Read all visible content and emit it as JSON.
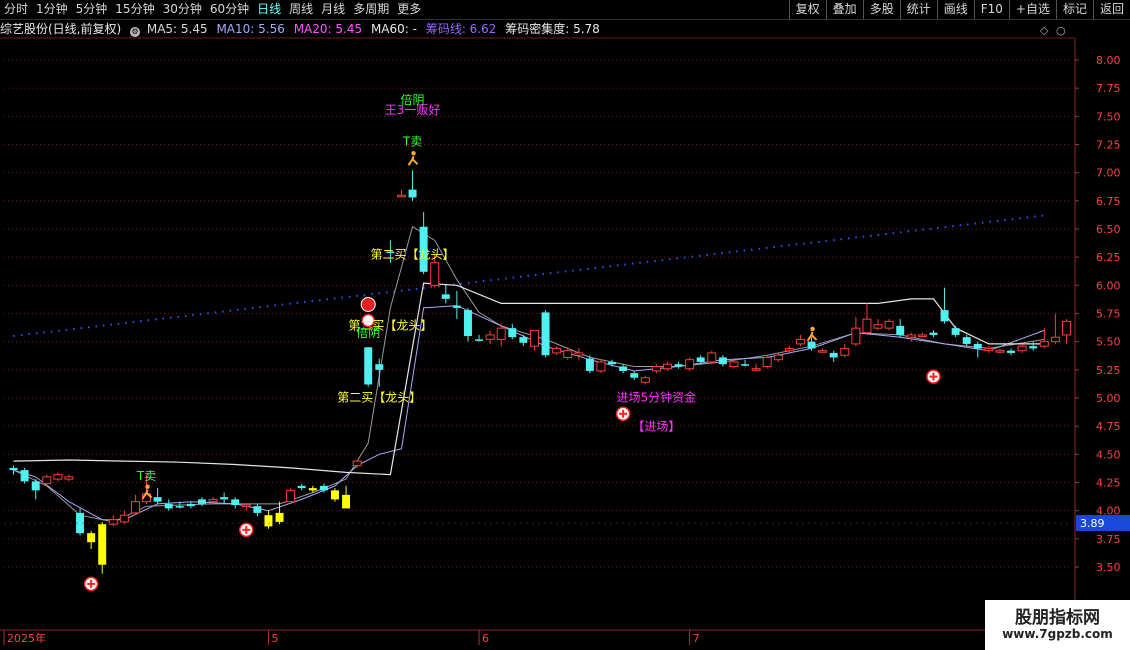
{
  "topbar": {
    "left": [
      "分时",
      "1分钟",
      "5分钟",
      "15分钟",
      "30分钟",
      "60分钟",
      "日线",
      "周线",
      "月线",
      "多周期",
      "更多"
    ],
    "active": "日线",
    "right": [
      "复权",
      "叠加",
      "多股",
      "统计",
      "画线",
      "F10",
      "+自选",
      "标记",
      "返回"
    ]
  },
  "info": {
    "stock": "综艺股份(日线,前复权)",
    "ma5": "MA5: 5.45",
    "ma10": "MA10: 5.56",
    "ma20": "MA20: 5.45",
    "ma60": "MA60: -",
    "chip_line": "筹码线: 6.62",
    "chip_density": "筹码密集度: 5.78"
  },
  "colors": {
    "up": "#ff3b3b",
    "down": "#4ff0f0",
    "special": "#ffff00",
    "ma_white": "#e6e6e6",
    "ma_purple": "#a8a8ff",
    "chip_blue": "#3050ff"
  },
  "chart_data": {
    "type": "candlestick",
    "ylim": [
      3.3,
      8.18
    ],
    "yticks": [
      "8.00",
      "7.75",
      "7.50",
      "7.25",
      "7.00",
      "6.75",
      "6.50",
      "6.25",
      "6.00",
      "5.75",
      "5.50",
      "5.25",
      "5.00",
      "4.75",
      "4.50",
      "4.25",
      "4.00",
      "3.75",
      "3.50"
    ],
    "current_price": "3.89",
    "x_labels": [
      {
        "label": "2025年",
        "index": 0
      },
      {
        "label": "5",
        "index": 23
      },
      {
        "label": "6",
        "index": 42
      },
      {
        "label": "7",
        "index": 61
      }
    ],
    "candles": [
      [
        4.38,
        4.36,
        4.4,
        4.32,
        "down"
      ],
      [
        4.36,
        4.26,
        4.38,
        4.24,
        "down"
      ],
      [
        4.26,
        4.18,
        4.28,
        4.1,
        "down"
      ],
      [
        4.24,
        4.3,
        4.32,
        4.22,
        "up"
      ],
      [
        4.28,
        4.32,
        4.34,
        4.26,
        "up"
      ],
      [
        4.3,
        4.28,
        4.32,
        4.26,
        "up"
      ],
      [
        3.98,
        3.8,
        4.02,
        3.78,
        "down"
      ],
      [
        3.8,
        3.72,
        3.82,
        3.66,
        "special"
      ],
      [
        3.88,
        3.52,
        3.9,
        3.44,
        "special"
      ],
      [
        3.88,
        3.92,
        3.96,
        3.86,
        "up"
      ],
      [
        3.9,
        3.96,
        4.0,
        3.88,
        "up"
      ],
      [
        3.98,
        4.08,
        4.14,
        3.96,
        "up"
      ],
      [
        4.08,
        4.15,
        4.32,
        4.06,
        "up"
      ],
      [
        4.12,
        4.08,
        4.2,
        4.06,
        "down"
      ],
      [
        4.06,
        4.02,
        4.1,
        4.0,
        "down"
      ],
      [
        4.04,
        4.04,
        4.08,
        4.02,
        "down"
      ],
      [
        4.04,
        4.06,
        4.08,
        4.02,
        "down"
      ],
      [
        4.06,
        4.1,
        4.12,
        4.04,
        "down"
      ],
      [
        4.08,
        4.1,
        4.12,
        4.06,
        "up"
      ],
      [
        4.1,
        4.12,
        4.16,
        4.06,
        "down"
      ],
      [
        4.1,
        4.05,
        4.12,
        4.02,
        "down"
      ],
      [
        4.04,
        4.05,
        4.06,
        4.0,
        "up"
      ],
      [
        4.04,
        3.98,
        4.06,
        3.95,
        "down"
      ],
      [
        3.96,
        3.86,
        4.0,
        3.84,
        "special"
      ],
      [
        3.9,
        3.98,
        4.08,
        3.88,
        "special"
      ],
      [
        4.08,
        4.18,
        4.2,
        4.08,
        "up"
      ],
      [
        4.22,
        4.2,
        4.24,
        4.18,
        "down"
      ],
      [
        4.18,
        4.2,
        4.22,
        4.16,
        "special"
      ],
      [
        4.22,
        4.18,
        4.24,
        4.16,
        "down"
      ],
      [
        4.18,
        4.1,
        4.2,
        4.08,
        "special"
      ],
      [
        4.14,
        4.02,
        4.22,
        4.02,
        "special"
      ],
      [
        4.4,
        4.44,
        4.44,
        4.38,
        "up"
      ],
      [
        5.12,
        5.45,
        5.45,
        5.1,
        "down"
      ],
      [
        5.3,
        5.25,
        5.35,
        5.1,
        "down"
      ],
      [
        6.3,
        6.3,
        6.4,
        6.2,
        "down"
      ],
      [
        6.8,
        6.8,
        6.85,
        6.78,
        "up"
      ],
      [
        6.85,
        6.78,
        7.02,
        6.75,
        "down"
      ],
      [
        6.52,
        6.12,
        6.65,
        6.1,
        "down"
      ],
      [
        6.0,
        6.2,
        6.28,
        5.98,
        "up"
      ],
      [
        5.92,
        5.88,
        6.0,
        5.84,
        "down"
      ],
      [
        5.82,
        5.8,
        5.95,
        5.7,
        "down"
      ],
      [
        5.78,
        5.55,
        5.8,
        5.5,
        "down"
      ],
      [
        5.52,
        5.52,
        5.56,
        5.5,
        "down"
      ],
      [
        5.52,
        5.56,
        5.6,
        5.48,
        "up"
      ],
      [
        5.52,
        5.62,
        5.66,
        5.46,
        "up"
      ],
      [
        5.62,
        5.54,
        5.66,
        5.52,
        "down"
      ],
      [
        5.54,
        5.49,
        5.56,
        5.46,
        "down"
      ],
      [
        5.46,
        5.6,
        5.6,
        5.42,
        "up"
      ],
      [
        5.76,
        5.38,
        5.78,
        5.36,
        "down"
      ],
      [
        5.4,
        5.44,
        5.46,
        5.38,
        "up"
      ],
      [
        5.42,
        5.36,
        5.45,
        5.34,
        "up"
      ],
      [
        5.38,
        5.4,
        5.44,
        5.34,
        "up"
      ],
      [
        5.35,
        5.24,
        5.38,
        5.22,
        "down"
      ],
      [
        5.24,
        5.32,
        5.34,
        5.22,
        "up"
      ],
      [
        5.32,
        5.3,
        5.34,
        5.28,
        "down"
      ],
      [
        5.28,
        5.24,
        5.3,
        5.22,
        "down"
      ],
      [
        5.22,
        5.18,
        5.24,
        5.16,
        "down"
      ],
      [
        5.14,
        5.18,
        5.2,
        5.12,
        "up"
      ],
      [
        5.24,
        5.28,
        5.3,
        5.22,
        "up"
      ],
      [
        5.26,
        5.3,
        5.32,
        5.24,
        "up"
      ],
      [
        5.3,
        5.28,
        5.32,
        5.26,
        "down"
      ],
      [
        5.26,
        5.34,
        5.36,
        5.24,
        "up"
      ],
      [
        5.36,
        5.32,
        5.38,
        5.3,
        "down"
      ],
      [
        5.32,
        5.4,
        5.42,
        5.3,
        "up"
      ],
      [
        5.36,
        5.3,
        5.38,
        5.28,
        "down"
      ],
      [
        5.28,
        5.32,
        5.34,
        5.26,
        "up"
      ],
      [
        5.3,
        5.3,
        5.34,
        5.28,
        "down"
      ],
      [
        5.26,
        5.26,
        5.3,
        5.24,
        "up"
      ],
      [
        5.28,
        5.36,
        5.38,
        5.26,
        "up"
      ],
      [
        5.34,
        5.38,
        5.4,
        5.32,
        "up"
      ],
      [
        5.42,
        5.44,
        5.46,
        5.4,
        "up"
      ],
      [
        5.48,
        5.52,
        5.56,
        5.46,
        "up"
      ],
      [
        5.5,
        5.44,
        5.54,
        5.42,
        "down"
      ],
      [
        5.42,
        5.42,
        5.44,
        5.4,
        "up"
      ],
      [
        5.4,
        5.36,
        5.42,
        5.32,
        "down"
      ],
      [
        5.38,
        5.44,
        5.48,
        5.36,
        "up"
      ],
      [
        5.48,
        5.62,
        5.72,
        5.46,
        "up"
      ],
      [
        5.58,
        5.7,
        5.84,
        5.56,
        "up"
      ],
      [
        5.62,
        5.65,
        5.7,
        5.6,
        "up"
      ],
      [
        5.62,
        5.68,
        5.7,
        5.6,
        "up"
      ],
      [
        5.64,
        5.56,
        5.7,
        5.54,
        "down"
      ],
      [
        5.56,
        5.54,
        5.58,
        5.5,
        "up"
      ],
      [
        5.56,
        5.56,
        5.58,
        5.54,
        "up"
      ],
      [
        5.58,
        5.56,
        5.6,
        5.54,
        "down"
      ],
      [
        5.68,
        5.78,
        5.98,
        5.66,
        "down"
      ],
      [
        5.62,
        5.56,
        5.64,
        5.54,
        "down"
      ],
      [
        5.54,
        5.48,
        5.56,
        5.46,
        "down"
      ],
      [
        5.48,
        5.44,
        5.5,
        5.36,
        "down"
      ],
      [
        5.44,
        5.42,
        5.46,
        5.4,
        "up"
      ],
      [
        5.42,
        5.42,
        5.44,
        5.4,
        "up"
      ],
      [
        5.4,
        5.42,
        5.44,
        5.38,
        "down"
      ],
      [
        5.42,
        5.46,
        5.48,
        5.4,
        "up"
      ],
      [
        5.44,
        5.46,
        5.5,
        5.42,
        "down"
      ],
      [
        5.46,
        5.5,
        5.62,
        5.44,
        "up"
      ],
      [
        5.5,
        5.54,
        5.75,
        5.48,
        "up"
      ],
      [
        5.56,
        5.68,
        5.7,
        5.48,
        "up"
      ]
    ],
    "ma_white": [
      [
        0,
        4.44
      ],
      [
        5,
        4.45
      ],
      [
        10,
        4.44
      ],
      [
        15,
        4.43
      ],
      [
        20,
        4.41
      ],
      [
        25,
        4.38
      ],
      [
        30,
        4.34
      ],
      [
        34,
        4.32
      ],
      [
        37,
        6.02
      ],
      [
        40,
        6.0
      ],
      [
        44,
        5.84
      ],
      [
        50,
        5.84
      ],
      [
        60,
        5.84
      ],
      [
        70,
        5.84
      ],
      [
        78,
        5.84
      ],
      [
        81,
        5.88
      ],
      [
        83,
        5.88
      ],
      [
        85,
        5.62
      ],
      [
        88,
        5.48
      ],
      [
        93,
        5.48
      ]
    ],
    "ma_purple": [
      [
        0,
        4.36
      ],
      [
        2,
        4.3
      ],
      [
        5,
        4.08
      ],
      [
        8,
        3.92
      ],
      [
        10,
        3.92
      ],
      [
        13,
        4.06
      ],
      [
        16,
        4.08
      ],
      [
        20,
        4.06
      ],
      [
        23,
        4.0
      ],
      [
        26,
        4.1
      ],
      [
        29,
        4.22
      ],
      [
        31,
        4.4
      ],
      [
        33,
        4.5
      ],
      [
        35,
        4.55
      ],
      [
        37,
        5.8
      ],
      [
        40,
        5.82
      ],
      [
        44,
        5.64
      ],
      [
        48,
        5.46
      ],
      [
        52,
        5.34
      ],
      [
        56,
        5.24
      ],
      [
        60,
        5.28
      ],
      [
        64,
        5.34
      ],
      [
        68,
        5.36
      ],
      [
        72,
        5.44
      ],
      [
        76,
        5.58
      ],
      [
        80,
        5.54
      ],
      [
        84,
        5.48
      ],
      [
        88,
        5.42
      ],
      [
        93,
        5.6
      ]
    ],
    "ma_gray": [
      [
        0,
        4.36
      ],
      [
        3,
        4.22
      ],
      [
        6,
        3.96
      ],
      [
        9,
        3.9
      ],
      [
        12,
        4.04
      ],
      [
        18,
        4.06
      ],
      [
        24,
        4.06
      ],
      [
        27,
        4.16
      ],
      [
        30,
        4.28
      ],
      [
        32,
        4.6
      ],
      [
        34,
        5.8
      ],
      [
        36,
        6.52
      ],
      [
        38,
        6.4
      ],
      [
        40,
        6.05
      ],
      [
        42,
        5.76
      ],
      [
        44,
        5.64
      ],
      [
        48,
        5.52
      ],
      [
        52,
        5.36
      ],
      [
        56,
        5.28
      ],
      [
        60,
        5.28
      ],
      [
        64,
        5.32
      ],
      [
        68,
        5.38
      ],
      [
        72,
        5.46
      ],
      [
        76,
        5.58
      ],
      [
        80,
        5.56
      ],
      [
        84,
        5.48
      ],
      [
        88,
        5.44
      ],
      [
        93,
        5.52
      ]
    ],
    "chip_line": [
      [
        0,
        5.55
      ],
      [
        93,
        6.62
      ]
    ],
    "annotations": [
      {
        "text": "T卖",
        "i": 12,
        "y": 4.27,
        "color": "#33ff33"
      },
      {
        "text": "T卖",
        "i": 36,
        "y": 7.24,
        "color": "#33ff33"
      },
      {
        "text": "倍阴",
        "i": 36,
        "y": 7.61,
        "color": "#33ff33"
      },
      {
        "text": "王3一贩好",
        "i": 36,
        "y": 7.52,
        "color": "#ff33ff"
      },
      {
        "text": "第二买【龙头】",
        "i": 36,
        "y": 6.24,
        "color": "#ffff33"
      },
      {
        "text": "第二买【龙头】",
        "i": 34,
        "y": 5.61,
        "color": "#ffff33"
      },
      {
        "text": "倍阴",
        "i": 32,
        "y": 5.54,
        "color": "#33ff33"
      },
      {
        "text": "第二买【龙头】",
        "i": 33,
        "y": 4.97,
        "color": "#ffff33"
      },
      {
        "text": "进场5分钟资金",
        "i": 58,
        "y": 4.97,
        "color": "#ff33ff"
      },
      {
        "text": "【进场】",
        "i": 58,
        "y": 4.71,
        "color": "#ff33ff"
      }
    ],
    "markers": [
      {
        "kind": "plus",
        "i": 7,
        "y": 3.35
      },
      {
        "kind": "plus",
        "i": 21,
        "y": 3.83
      },
      {
        "kind": "plus",
        "i": 55,
        "y": 4.86
      },
      {
        "kind": "plus",
        "i": 83,
        "y": 5.19
      },
      {
        "kind": "can",
        "i": 32,
        "y": 5.83
      }
    ],
    "runners": [
      {
        "i": 12,
        "y": 4.16
      },
      {
        "i": 36,
        "y": 7.12
      },
      {
        "i": 72,
        "y": 5.56
      }
    ]
  },
  "watermark": {
    "line1": "股朋指标网",
    "line2": "www.7gpzb.com"
  }
}
